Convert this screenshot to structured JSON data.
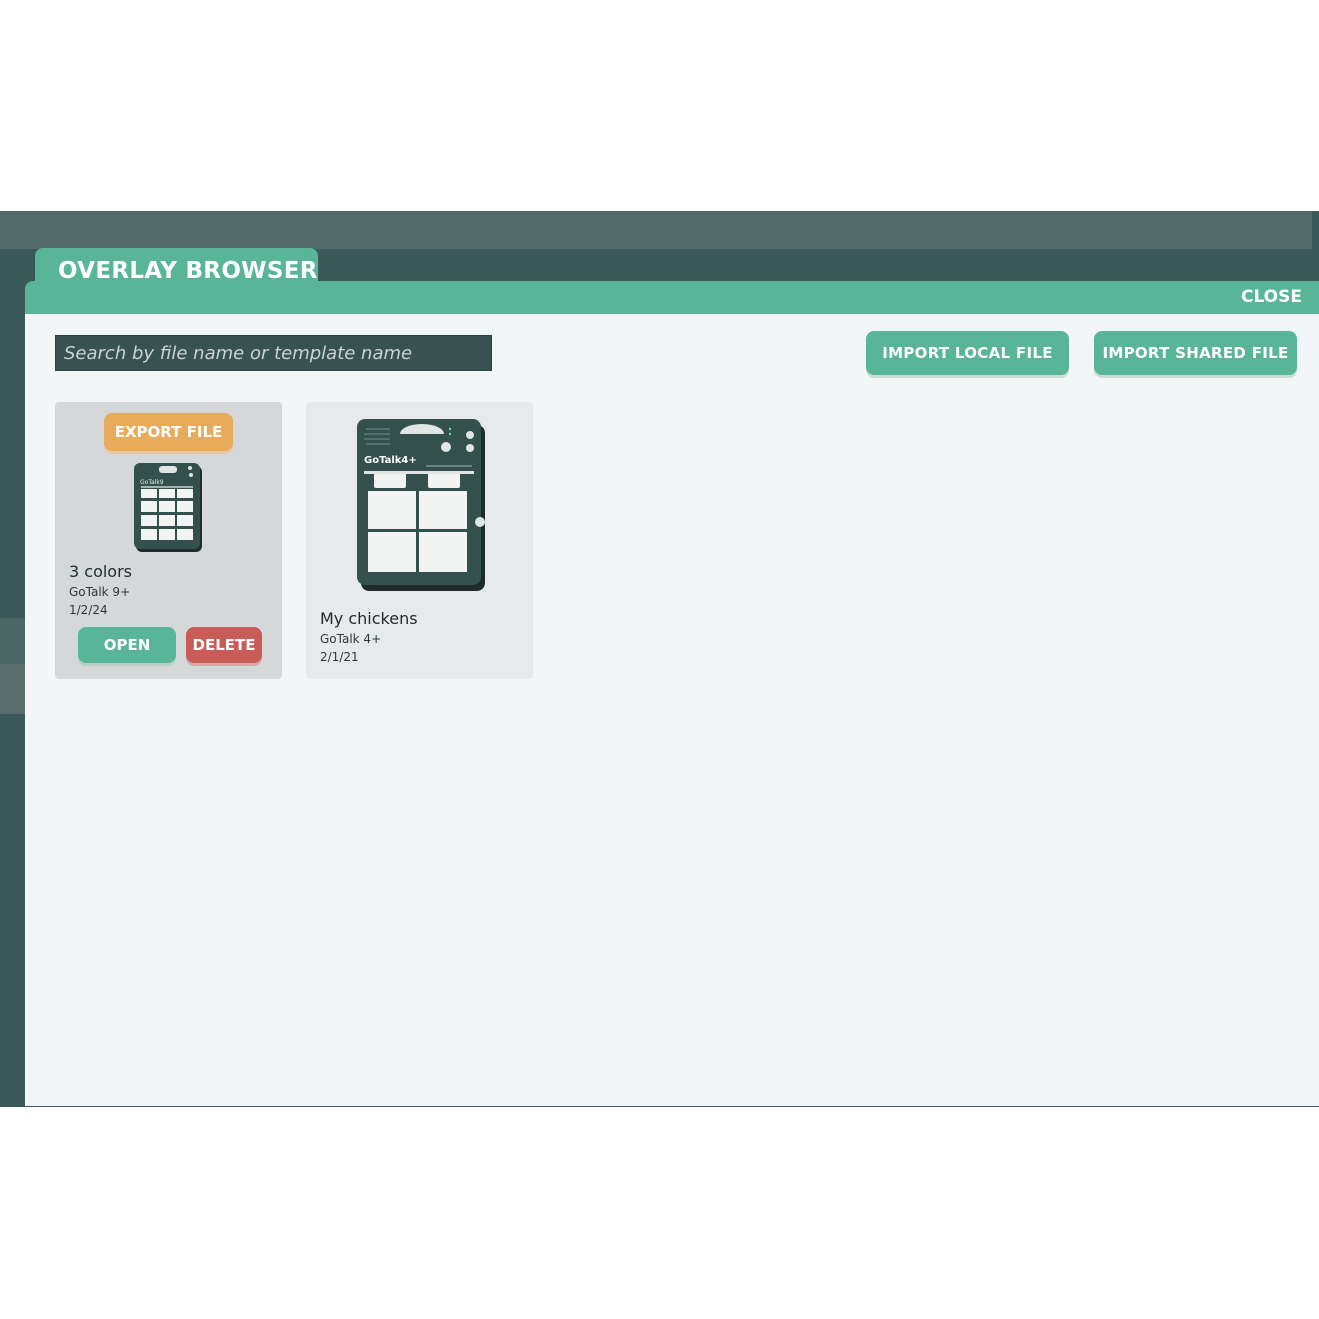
{
  "window": {
    "title": "OVERLAY BROWSER",
    "close_label": "CLOSE"
  },
  "search": {
    "placeholder": "Search by file name or template name",
    "value": ""
  },
  "actions": {
    "import_local_label": "IMPORT LOCAL FILE",
    "import_shared_label": "IMPORT SHARED FILE"
  },
  "files": [
    {
      "name": "3 colors",
      "template": "GoTalk 9+",
      "date": "1/2/24",
      "selected": true,
      "export_label": "EXPORT FILE",
      "open_label": "OPEN",
      "delete_label": "DELETE"
    },
    {
      "name": "My chickens",
      "template": "GoTalk 4+",
      "date": "2/1/21",
      "selected": false,
      "device_brand": "GoTalk4+"
    }
  ],
  "colors": {
    "accent": "#58b597",
    "export": "#e8ab5c",
    "delete": "#c95b59",
    "frame": "#3a5958",
    "panel": "#f2f6f7"
  }
}
